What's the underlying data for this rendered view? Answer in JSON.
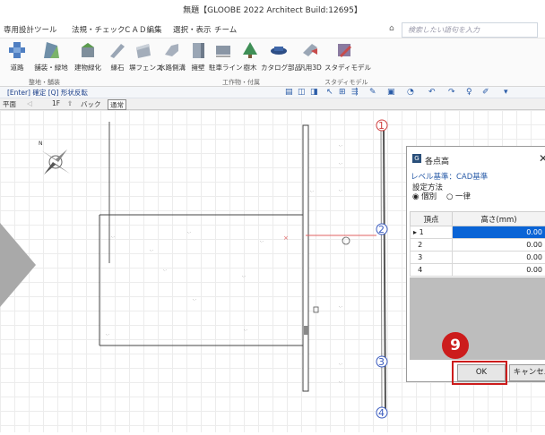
{
  "window": {
    "title": "無題【GLOOBE 2022 Architect Build:12695】"
  },
  "menu": [
    {
      "label": "専用設計ツール"
    },
    {
      "label": "法規・チェック"
    },
    {
      "label": "ＣＡＤ編集"
    },
    {
      "label": "選択・表示"
    },
    {
      "label": "チーム"
    }
  ],
  "search": {
    "placeholder": "検索したい語句を入力"
  },
  "ribbon": {
    "buttons": [
      {
        "label": "道路",
        "icon": "road-icon"
      },
      {
        "label": "舗装・緑地",
        "icon": "pavement-icon"
      },
      {
        "label": "建物緑化",
        "icon": "building-greening-icon"
      },
      {
        "label": "縁石",
        "icon": "curb-icon"
      },
      {
        "label": "塀フェンス",
        "icon": "fence-icon"
      },
      {
        "label": "水路側溝",
        "icon": "gutter-icon"
      },
      {
        "label": "擁壁",
        "icon": "retaining-wall-icon"
      },
      {
        "label": "駐車ライン",
        "icon": "parking-line-icon"
      },
      {
        "label": "樹木",
        "icon": "tree-icon"
      },
      {
        "label": "カタログ部品",
        "icon": "catalog-parts-icon"
      },
      {
        "label": "汎用3D",
        "icon": "generic-3d-icon"
      },
      {
        "label": "スタディモデル",
        "icon": "study-model-icon"
      }
    ],
    "groups": [
      "整地・舗装",
      "工作物・付属",
      "スタディモデル"
    ]
  },
  "statusbar": {
    "hint": "[Enter] 確定 [Q] 形状反転"
  },
  "viewbar": {
    "tabs": [
      "平面",
      "1F",
      "バック",
      "通常"
    ]
  },
  "canvas": {
    "markers": [
      "1",
      "2",
      "3",
      "4"
    ]
  },
  "dialog": {
    "title": "各点高",
    "level_label": "レベル基準：CAD基準",
    "method_label": "設定方法",
    "radio_individual": "◉ 個別",
    "radio_uniform": "○ 一律",
    "columns": [
      "頂点",
      "高さ(mm)"
    ],
    "rows": [
      {
        "vertex": "1",
        "height": "0.00",
        "selected": true
      },
      {
        "vertex": "2",
        "height": "0.00"
      },
      {
        "vertex": "3",
        "height": "0.00"
      },
      {
        "vertex": "4",
        "height": "0.00"
      }
    ],
    "ok": "OK",
    "cancel": "キャンセル"
  },
  "callout": {
    "step": "9"
  },
  "colors": {
    "accent": "#cc1c1c",
    "selection": "#0a64d6",
    "marker": "#d04040",
    "marker_blue": "#3a5bbf"
  }
}
